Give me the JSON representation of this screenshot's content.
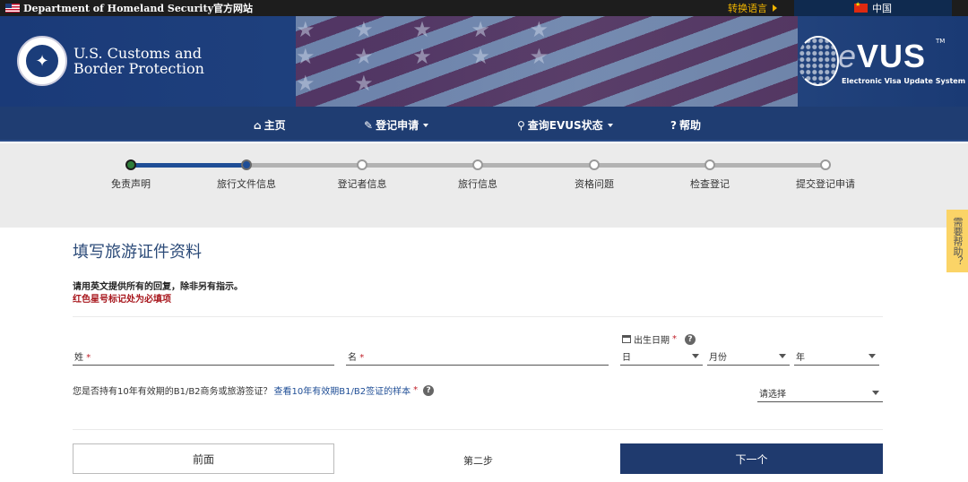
{
  "topbar": {
    "agency_text": "Department of Homeland Security官方网站",
    "switch_language": "转换语言",
    "current_language": "中国"
  },
  "banner": {
    "cbp_line1": "U.S. Customs and",
    "cbp_line2": "Border Protection",
    "evus_logo_e": "e",
    "evus_logo_rest": "VUS",
    "evus_tm": "TM",
    "evus_subtitle": "Electronic Visa Update System"
  },
  "nav": {
    "items": [
      {
        "label": "主页",
        "icon": "home-icon"
      },
      {
        "label": "登记申请",
        "icon": "pencil-icon"
      },
      {
        "label": "查询EVUS状态",
        "icon": "search-icon"
      },
      {
        "label": "帮助",
        "icon": "question-circle-icon"
      }
    ]
  },
  "progress": {
    "steps": [
      {
        "label": "免责声明",
        "state": "done"
      },
      {
        "label": "旅行文件信息",
        "state": "current"
      },
      {
        "label": "登记者信息",
        "state": "todo"
      },
      {
        "label": "旅行信息",
        "state": "todo"
      },
      {
        "label": "资格问题",
        "state": "todo"
      },
      {
        "label": "检查登记",
        "state": "todo"
      },
      {
        "label": "提交登记申请",
        "state": "todo"
      }
    ],
    "current_index": 1
  },
  "help_tab": {
    "label": "需要帮助？"
  },
  "form": {
    "title": "填写旅游证件资料",
    "note_english": "请用英文提供所有的回复，除非另有指示。",
    "note_required": "红色星号标记处为必填项",
    "surname_label": "姓",
    "given_name_label": "名",
    "dob_label": "出生日期",
    "dob_day": "日",
    "dob_month": "月份",
    "dob_year": "年",
    "required_mark": "*",
    "visa_question": "您是否持有10年有效期的B1/B2商务或旅游签证？",
    "visa_sample_link": "查看10年有效期B1/B2签证的样本",
    "visa_select": "请选择"
  },
  "footer": {
    "prev_button": "前面",
    "step_label": "第二步",
    "next_button": "下一个"
  },
  "colors": {
    "navy": "#1f3d72",
    "progress_blue": "#1f4e96",
    "required_red": "#a8181e",
    "help_tab_yellow": "#fbd467",
    "topbar_gold": "#f0b400"
  }
}
